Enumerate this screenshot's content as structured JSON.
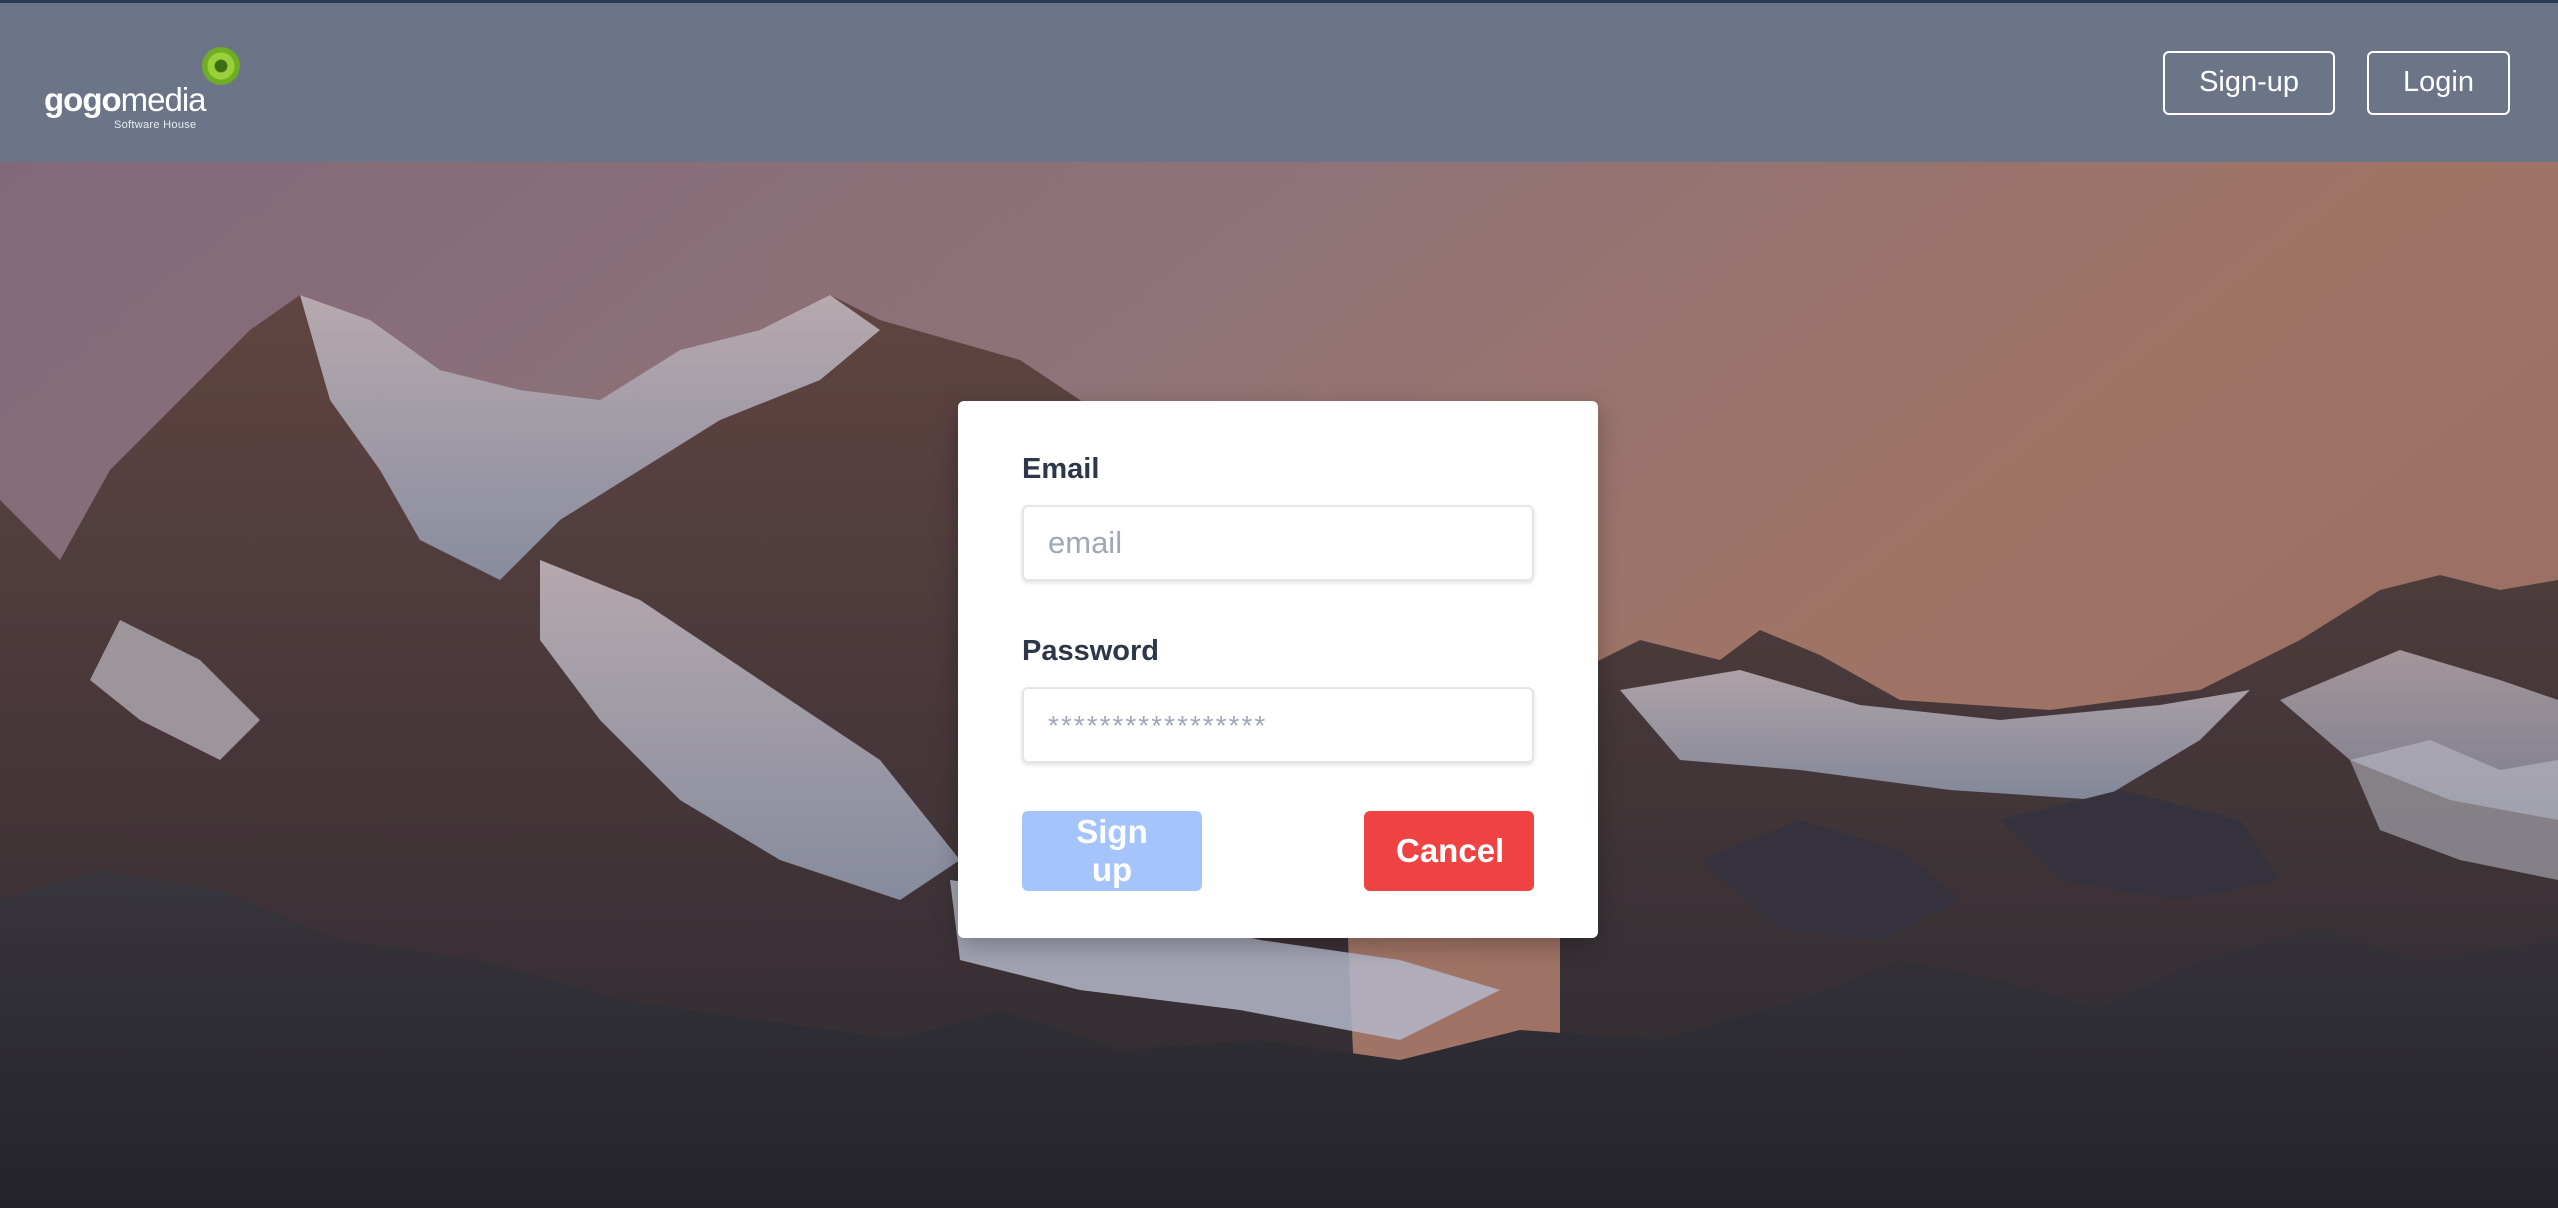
{
  "header": {
    "logo": {
      "brand_bold": "gogo",
      "brand_light": "media",
      "tagline": "Software House"
    },
    "buttons": {
      "signup_label": "Sign-up",
      "login_label": "Login"
    }
  },
  "form": {
    "email": {
      "label": "Email",
      "placeholder": "email",
      "value": ""
    },
    "password": {
      "label": "Password",
      "placeholder": "*****************",
      "value": ""
    },
    "submit_label": "Sign up",
    "cancel_label": "Cancel"
  },
  "colors": {
    "header_bg": "#6b7587",
    "submit_bg": "#a4c4fb",
    "cancel_bg": "#ef4343",
    "label_text": "#2d3748"
  },
  "background": {
    "subject": "snowy mountain range at dusk"
  }
}
